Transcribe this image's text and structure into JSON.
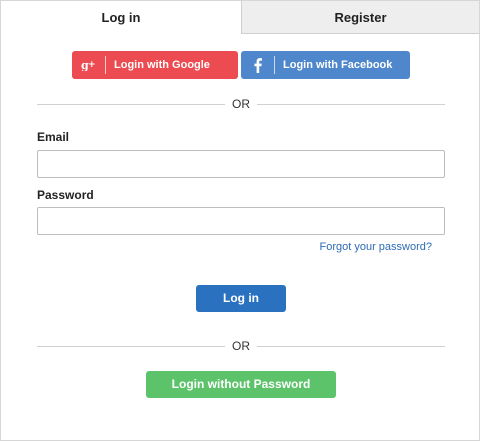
{
  "tabs": {
    "login": "Log in",
    "register": "Register"
  },
  "social": {
    "google_label": "Login with Google",
    "google_icon": "google-plus-icon",
    "facebook_label": "Login with Facebook",
    "facebook_icon": "facebook-icon",
    "google_color": "#ec4b51",
    "facebook_color": "#4f87cc"
  },
  "divider_text": "OR",
  "form": {
    "email_label": "Email",
    "email_value": "",
    "password_label": "Password",
    "password_value": "",
    "forgot_link": "Forgot your password?",
    "login_button": "Log in"
  },
  "passwordless_button": "Login without Password",
  "colors": {
    "primary": "#2a72bf",
    "success": "#5cc36a",
    "link": "#2d6cb3"
  }
}
